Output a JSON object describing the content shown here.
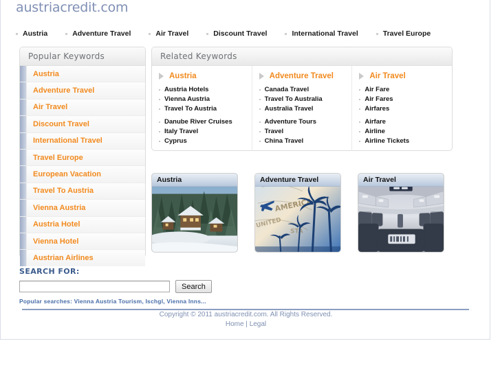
{
  "site": {
    "logo": "austriacredit.com"
  },
  "topnav": {
    "items": [
      {
        "label": "Austria"
      },
      {
        "label": "Adventure Travel"
      },
      {
        "label": "Air Travel"
      },
      {
        "label": "Discount Travel"
      },
      {
        "label": "International Travel"
      },
      {
        "label": "Travel Europe"
      }
    ]
  },
  "sidebar": {
    "title": "Popular Keywords",
    "items": [
      {
        "label": "Austria"
      },
      {
        "label": "Adventure Travel"
      },
      {
        "label": "Air Travel"
      },
      {
        "label": "Discount Travel"
      },
      {
        "label": "International Travel"
      },
      {
        "label": "Travel Europe"
      },
      {
        "label": "European Vacation"
      },
      {
        "label": "Travel To Austria"
      },
      {
        "label": "Vienna Austria"
      },
      {
        "label": "Austria Hotel"
      },
      {
        "label": "Vienna Hotel"
      },
      {
        "label": "Austrian Airlines"
      }
    ]
  },
  "related": {
    "title": "Related Keywords",
    "columns": [
      {
        "heading": "Austria",
        "group1": [
          "Austria Hotels",
          "Vienna Austria",
          "Travel To Austria"
        ],
        "group2": [
          "Danube River Cruises",
          "Italy Travel",
          "Cyprus"
        ]
      },
      {
        "heading": "Adventure Travel",
        "group1": [
          "Canada Travel",
          "Travel To Australia",
          "Australia Travel"
        ],
        "group2": [
          "Adventure Tours",
          "Travel",
          "China Travel"
        ]
      },
      {
        "heading": "Air Travel",
        "group1": [
          "Air Fare",
          "Air Fares",
          "Airfares"
        ],
        "group2": [
          "Airfare",
          "Airline",
          "Airline Tickets"
        ]
      }
    ]
  },
  "cards": [
    {
      "title": "Austria",
      "image": "snowy-alpine-chalet-photo"
    },
    {
      "title": "Adventure Travel",
      "image": "palm-trees-map-collage-photo"
    },
    {
      "title": "Air Travel",
      "image": "airplane-cabin-interior-photo"
    }
  ],
  "search": {
    "label": "SEARCH FOR:",
    "value": "",
    "placeholder": "",
    "button": "Search",
    "popular": "Popular searches: Vienna Austria Tourism, Ischgl, Vienna Inns..."
  },
  "footer": {
    "copyright": "Copyright © 2011 austriacredit.com. All Rights Reserved.",
    "home": "Home",
    "separator": " | ",
    "legal": "Legal"
  },
  "colors": {
    "accent_orange": "#f28a1e",
    "logo_blue": "#7f8fb4",
    "footer_blue": "#7f90b2",
    "label_blue": "#3a5b8c"
  }
}
